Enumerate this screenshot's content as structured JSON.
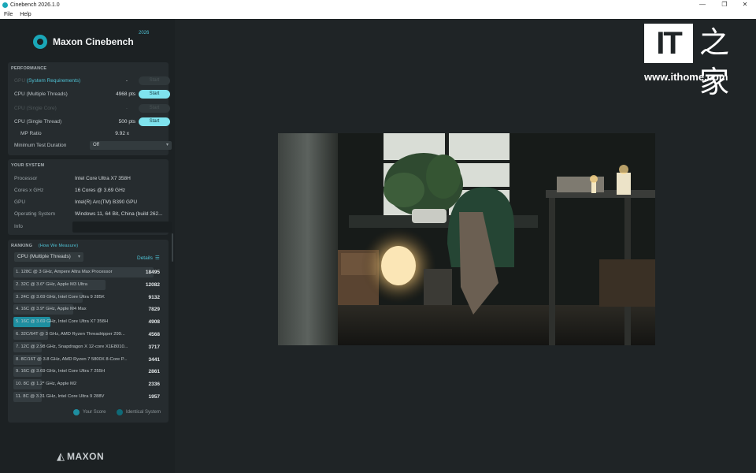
{
  "window": {
    "title": "Cinebench 2026.1.0"
  },
  "menu": [
    "File",
    "Help"
  ],
  "brand": {
    "name": "Maxon Cinebench",
    "year": "2026",
    "footer": "MAXON"
  },
  "performance": {
    "title": "PERFORMANCE",
    "gpu": {
      "label": "GPU",
      "link": "(System Requirements)",
      "value": "-",
      "button": "Start"
    },
    "cpu_multi": {
      "label": "CPU (Multiple Threads)",
      "value": "4968 pts",
      "button": "Start"
    },
    "cpu_single_core": {
      "label": "CPU (Single Core)",
      "value": "-",
      "button": "Start"
    },
    "cpu_single": {
      "label": "CPU (Single Thread)",
      "value": "500 pts",
      "button": "Start"
    },
    "mp_ratio": {
      "label": "MP Ratio",
      "value": "9.92 x"
    },
    "min_duration": {
      "label": "Minimum Test Duration",
      "value": "Off"
    }
  },
  "system": {
    "title": "YOUR SYSTEM",
    "processor": {
      "label": "Processor",
      "value": "Intel Core Ultra X7 358H"
    },
    "cores": {
      "label": "Cores x GHz",
      "value": "16 Cores @ 3.69 GHz"
    },
    "gpu": {
      "label": "GPU",
      "value": "Intel(R) Arc(TM) B390 GPU"
    },
    "os": {
      "label": "Operating System",
      "value": "Windows 11, 64 Bit, China (build 262..."
    },
    "info": {
      "label": "Info",
      "value": ""
    }
  },
  "ranking": {
    "title": "RANKING",
    "link": "(How We Measure)",
    "mode": "CPU (Multiple Threads)",
    "details": "Details",
    "max_score": 18495,
    "rows": [
      {
        "label": "1. 128C @ 3 GHz, Ampere Altra Max Processor",
        "score": 18495,
        "mine": false
      },
      {
        "label": "2. 32C @ 3.6* GHz, Apple M3 Ultra",
        "score": 12082,
        "mine": false
      },
      {
        "label": "3. 24C @ 3.69 GHz, Intel Core Ultra 9 285K",
        "score": 9132,
        "mine": false
      },
      {
        "label": "4. 16C @ 3.9* GHz, Apple M4 Max",
        "score": 7829,
        "mine": false
      },
      {
        "label": "5. 16C @ 3.69 GHz, Intel Core Ultra X7 358H",
        "score": 4908,
        "mine": true
      },
      {
        "label": "6. 32C/64T @ 3 GHz, AMD Ryzen Threadripper 299...",
        "score": 4568,
        "mine": false
      },
      {
        "label": "7. 12C @ 2.98 GHz, Snapdragon X 12-core X1E8010...",
        "score": 3717,
        "mine": false
      },
      {
        "label": "8. 8C/16T @ 3.8 GHz, AMD Ryzen 7 5800X 8-Core P...",
        "score": 3441,
        "mine": false
      },
      {
        "label": "9. 16C @ 3.69 GHz, Intel Core Ultra 7 255H",
        "score": 2861,
        "mine": false
      },
      {
        "label": "10. 8C @ 1.2* GHz, Apple M2",
        "score": 2336,
        "mine": false
      },
      {
        "label": "11. 8C @ 3.31 GHz, Intel Core Ultra 9 288V",
        "score": 1957,
        "mine": false
      }
    ],
    "legend": {
      "yours": "Your Score",
      "identical": "Identical System"
    }
  },
  "colors": {
    "accent": "#4fc3d6",
    "button": "#7fe3ee",
    "mine_bar": "#1e8ea0",
    "identical": "#0f6a77"
  },
  "watermark": {
    "logo": "IT",
    "chinese": "之家",
    "url": "www.ithome.com"
  }
}
